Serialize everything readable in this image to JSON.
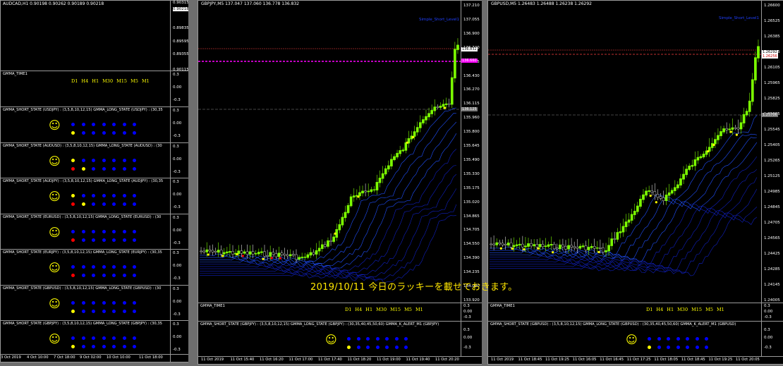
{
  "left_window": {
    "title": "AUDCAD,H1  0.90198 0.90262 0.90189 0.90218",
    "price_ticks": [
      "0.90315",
      "0.90218",
      "0.89835",
      "0.89595",
      "0.89355",
      "0.90115"
    ],
    "price_tag": "0.90218",
    "timeframes": "D1 H4 H1 M30 M15 M5 M1",
    "time_label": "GMMA_TIME1",
    "sub_ticks": [
      "0.3",
      "0.00",
      "-0.3"
    ],
    "panels": [
      {
        "label": "GMMA_SHORT_STATE (USDJPY) : (3,5,8,10,12,15)  GMMA_LONG_STATE (USDJPY) : (30,35",
        "top": [
          "blue",
          "blue",
          "blue",
          "blue",
          "blue",
          "blue",
          "blue"
        ],
        "bottom": [
          "yellow",
          "blue",
          "blue",
          "blue",
          "blue",
          "blue",
          "blue"
        ]
      },
      {
        "label": "GMMA_SHORT_STATE (AUDUSD) : (3,5,8,10,12,15)  GMMA_LONG_STATE (AUDUSD) : (30",
        "top": [
          "yellow",
          "blue",
          "blue",
          "blue",
          "blue",
          "blue",
          "blue"
        ],
        "bottom": [
          "red",
          "yellow",
          "blue",
          "blue",
          "blue",
          "blue",
          "blue"
        ]
      },
      {
        "label": "GMMA_SHORT_STATE (AUDJPY) : (3,5,8,10,12,15)  GMMA_LONG_STATE (AUDJPY) : (30,35",
        "top": [
          "yellow",
          "blue",
          "blue",
          "blue",
          "blue",
          "blue",
          "blue"
        ],
        "bottom": [
          "red",
          "yellow",
          "blue",
          "blue",
          "blue",
          "blue",
          "blue"
        ]
      },
      {
        "label": "GMMA_SHORT_STATE (EURUSD) : (3,5,8,10,12,15)  GMMA_LONG_STATE (EURUSD) : (30",
        "top": [
          "blue",
          "blue",
          "blue",
          "blue",
          "blue",
          "blue",
          "blue"
        ],
        "bottom": [
          "red",
          "blue",
          "blue",
          "blue",
          "blue",
          "blue",
          "blue"
        ]
      },
      {
        "label": "GMMA_SHORT_STATE (EURJPY) : (3,5,8,10,12,15)  GMMA_LONG_STATE (EURJPY) : (30,35",
        "top": [
          "blue",
          "blue",
          "blue",
          "blue",
          "blue",
          "blue",
          "blue"
        ],
        "bottom": [
          "red",
          "blue",
          "blue",
          "blue",
          "blue",
          "blue",
          "blue"
        ]
      },
      {
        "label": "GMMA_SHORT_STATE (GBPUSD) : (3,5,8,10,12,15)  GMMA_LONG_STATE (GBPUSD) : (30",
        "top": [
          "blue",
          "blue",
          "blue",
          "blue",
          "blue",
          "blue",
          "blue"
        ],
        "bottom": [
          "yellow",
          "blue",
          "blue",
          "blue",
          "blue",
          "blue",
          "blue"
        ]
      },
      {
        "label": "GMMA_SHORT_STATE (GBPJPY) : (3,5,8,10,12,15)  GMMA_LONG_STATE (GBPJPY) : (30,35",
        "top": [
          "blue",
          "blue",
          "blue",
          "blue",
          "blue",
          "blue",
          "blue"
        ],
        "bottom": [
          "yellow",
          "blue",
          "blue",
          "blue",
          "blue",
          "blue",
          "blue"
        ]
      }
    ],
    "time_ticks": [
      "3 Oct 2019",
      "4 Oct 10:00",
      "7 Oct 18:00",
      "9 Oct 02:00",
      "10 Oct 10:00",
      "11 Oct 18:00"
    ]
  },
  "middle_window": {
    "title": "GBPJPY,M5  137.047 137.060 136.778 136.832",
    "indicator_name": "Simple_Short_Level1",
    "price_ticks": [
      "137.210",
      "137.055",
      "136.900",
      "136.740",
      "136.585",
      "136.430",
      "136.270",
      "136.115",
      "135.960",
      "135.800",
      "135.645",
      "135.490",
      "135.330",
      "135.175",
      "135.020",
      "134.865",
      "134.705",
      "134.550",
      "134.390",
      "134.235",
      "134.080",
      "133.920"
    ],
    "tag_bid": "136.832",
    "tag_line": "136.660",
    "tag_grey": "136.125",
    "time_label": "GMMA_TIME1",
    "timeframes": "D1 H4 H1 M30 M15 M5 M1",
    "panel_label": "GMMA_SHORT_STATE (GBPJPY) : (3,5,8,10,12,15)  GMMA_LONG_STATE (GBPJPY) : (30,35,40,45,50,60)   GMMA_K_ALERT_M1 (GBPJPY)",
    "sub_ticks": [
      "0.3",
      "0.00",
      "-0.3"
    ],
    "sub_ticks2": [
      "0.3",
      "0.00",
      "-0.3"
    ],
    "dots_top": [
      "blue",
      "blue",
      "blue",
      "blue",
      "blue",
      "blue",
      "blue"
    ],
    "dots_bottom": [
      "yellow",
      "blue",
      "blue",
      "blue",
      "blue",
      "blue",
      "blue"
    ],
    "time_ticks": [
      "11 Oct 2019",
      "11 Oct 15:40",
      "11 Oct 16:20",
      "11 Oct 17:00",
      "11 Oct 17:40",
      "11 Oct 18:20",
      "11 Oct 19:00",
      "11 Oct 19:40",
      "11 Oct 20:20"
    ]
  },
  "right_window": {
    "title": "GBPUSD,M5  1.26483 1.26488 1.26238 1.26292",
    "indicator_name": "Simple_Short_Level1",
    "price_ticks": [
      "1.26600",
      "1.26525",
      "1.26385",
      "1.26245",
      "1.26105",
      "1.25965",
      "1.25825",
      "1.25685",
      "1.25545",
      "1.25405",
      "1.25265",
      "1.25125",
      "1.24985",
      "1.24845",
      "1.24705",
      "1.24565",
      "1.24425",
      "1.24285",
      "1.24145",
      "1.24005"
    ],
    "tag_bid": "1.26292",
    "tag_line": "1.26256",
    "tag_grey": "1.25706",
    "time_label": "GMMA_TIME1",
    "timeframes": "D1 H4 H1 M30 M15 M5 M1",
    "panel_label": "GMMA_SHORT_STATE (GBPUSD) : (3,5,8,10,12,15)  GMMA_LONG_STATE (GBPUSD) : (30,35,40,45,50,60)   GMMA_K_ALERT_M1 (GBPUSD)",
    "sub_ticks": [
      "0.3",
      "0.00",
      "-0.3"
    ],
    "sub_ticks2": [
      "0.3",
      "0.00",
      "-0.3"
    ],
    "dots_top": [
      "blue",
      "blue",
      "blue",
      "blue",
      "blue",
      "blue",
      "blue"
    ],
    "dots_bottom": [
      "yellow",
      "blue",
      "blue",
      "blue",
      "blue",
      "blue",
      "blue"
    ],
    "time_ticks": [
      "11 Oct 2019",
      "11 Oct 18:45",
      "11 Oct 19:25",
      "11 Oct 16:05",
      "11 Oct 16:45",
      "11 Oct 17:25",
      "11 Oct 18:05",
      "11 Oct 18:45",
      "11 Oct 19:25",
      "11 Oct 20:05"
    ]
  },
  "caption": "2019/10/11 今日のラッキーを載せておきます。",
  "colors": {
    "blue": "#0000ff",
    "yellow": "#ffff00",
    "red": "#ff0000",
    "bull": "#7cfc00",
    "magenta": "#ff00ff"
  }
}
